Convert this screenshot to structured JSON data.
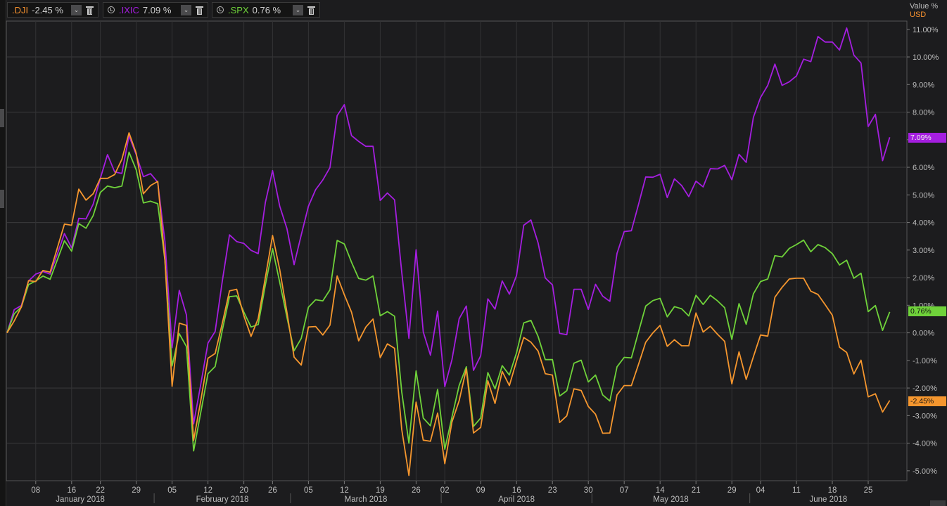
{
  "tabs": [
    {
      "symbol": ".DJI",
      "value": "-2.45 %",
      "color": "#f5902e",
      "has_clock": false
    },
    {
      "symbol": ".IXIC",
      "value": "7.09 %",
      "color": "#a51ee0",
      "has_clock": true
    },
    {
      "symbol": ".SPX",
      "value": "0.76 %",
      "color": "#6fd23a",
      "has_clock": true
    }
  ],
  "axis_header": {
    "title": "Value %",
    "currency": "USD"
  },
  "last_value_labels": [
    {
      "series": ".IXIC",
      "text": "7.09%",
      "bg": "#a51ee0",
      "fg": "#f0f0f0"
    },
    {
      "series": ".SPX",
      "text": "0.76%",
      "bg": "#6fd23a",
      "fg": "#111111"
    },
    {
      "series": ".DJI",
      "text": "-2.45%",
      "bg": "#f5962e",
      "fg": "#111111"
    }
  ],
  "chart_data": {
    "type": "line",
    "title": "",
    "ylabel": "Value %",
    "ylim": [
      -5.36,
      11.3
    ],
    "y_ticks": [
      "11.00%",
      "10.00%",
      "9.00%",
      "8.00%",
      "7.00%",
      "6.00%",
      "5.00%",
      "4.00%",
      "3.00%",
      "2.00%",
      "1.00%",
      "0.00%",
      "-1.00%",
      "-2.00%",
      "-3.00%",
      "-4.00%",
      "-5.00%"
    ],
    "y_tick_values": [
      11,
      10,
      9,
      8,
      7,
      6,
      5,
      4,
      3,
      2,
      1,
      0,
      -1,
      -2,
      -3,
      -4,
      -5
    ],
    "grid": true,
    "x_count": 124,
    "x_ticks": [
      {
        "label": "08",
        "i": 4
      },
      {
        "label": "16",
        "i": 9
      },
      {
        "label": "22",
        "i": 13
      },
      {
        "label": "29",
        "i": 18
      },
      {
        "label": "05",
        "i": 23
      },
      {
        "label": "12",
        "i": 28
      },
      {
        "label": "20",
        "i": 33
      },
      {
        "label": "26",
        "i": 37
      },
      {
        "label": "05",
        "i": 42
      },
      {
        "label": "12",
        "i": 47
      },
      {
        "label": "19",
        "i": 52
      },
      {
        "label": "26",
        "i": 57
      },
      {
        "label": "02",
        "i": 61
      },
      {
        "label": "09",
        "i": 66
      },
      {
        "label": "16",
        "i": 71
      },
      {
        "label": "23",
        "i": 76
      },
      {
        "label": "30",
        "i": 81
      },
      {
        "label": "07",
        "i": 86
      },
      {
        "label": "14",
        "i": 91
      },
      {
        "label": "21",
        "i": 96
      },
      {
        "label": "29",
        "i": 101
      },
      {
        "label": "04",
        "i": 105
      },
      {
        "label": "11",
        "i": 110
      },
      {
        "label": "18",
        "i": 115
      },
      {
        "label": "25",
        "i": 120
      }
    ],
    "months": [
      {
        "label": "January 2018",
        "start": 0
      },
      {
        "label": "February 2018",
        "start": 21
      },
      {
        "label": "March 2018",
        "start": 40
      },
      {
        "label": "April 2018",
        "start": 61
      },
      {
        "label": "May 2018",
        "start": 82
      },
      {
        "label": "June 2018",
        "start": 104
      }
    ],
    "series": [
      {
        "name": ".IXIC",
        "color": "#a51ee0",
        "values": [
          0,
          0.84,
          0.99,
          1.88,
          2.13,
          2.22,
          2.13,
          2.85,
          3.6,
          3.08,
          4.15,
          4.13,
          4.66,
          5.6,
          6.46,
          5.83,
          5.78,
          7.14,
          6.46,
          5.66,
          5.77,
          5.46,
          3.32,
          -0.54,
          1.54,
          0.65,
          -3.3,
          -1.86,
          -0.37,
          0.05,
          1.88,
          3.55,
          3.31,
          3.24,
          2.99,
          2.87,
          4.73,
          5.88,
          4.59,
          3.78,
          2.47,
          3.55,
          4.59,
          5.19,
          5.54,
          5.99,
          7.87,
          8.27,
          7.15,
          6.94,
          6.76,
          6.76,
          4.8,
          5.07,
          4.82,
          2.2,
          -0.2,
          3.01,
          0.03,
          -0.81,
          0.79,
          -1.95,
          -0.97,
          0.51,
          0.97,
          -1.36,
          -0.83,
          1.23,
          0.86,
          1.88,
          1.4,
          2.08,
          3.9,
          4.09,
          3.26,
          1.99,
          1.74,
          -0.02,
          -0.07,
          1.58,
          1.58,
          0.85,
          1.76,
          1.33,
          1.14,
          2.88,
          3.67,
          3.7,
          4.66,
          5.65,
          5.64,
          5.75,
          4.9,
          5.58,
          5.34,
          4.94,
          5.5,
          5.29,
          5.95,
          5.94,
          6.07,
          5.55,
          6.47,
          6.18,
          7.81,
          8.53,
          8.97,
          9.74,
          8.97,
          9.1,
          9.31,
          9.92,
          9.83,
          10.74,
          10.54,
          10.54,
          10.25,
          11.05,
          10.07,
          9.78,
          7.48,
          7.92,
          6.24,
          7.09
        ]
      },
      {
        "name": ".SPX",
        "color": "#6fd23a",
        "values": [
          0,
          0.69,
          0.94,
          1.75,
          1.88,
          2.06,
          1.94,
          2.64,
          3.34,
          2.96,
          3.96,
          3.79,
          4.25,
          5.09,
          5.32,
          5.26,
          5.32,
          6.55,
          5.91,
          4.71,
          4.77,
          4.68,
          2.64,
          -1.2,
          -0.03,
          -0.5,
          -4.28,
          -2.88,
          -1.48,
          -1.22,
          0.1,
          1.31,
          1.34,
          0.75,
          0.21,
          0.3,
          1.74,
          3.05,
          1.83,
          0.57,
          -0.65,
          -0.2,
          0.93,
          1.2,
          1.16,
          1.56,
          3.35,
          3.22,
          2.56,
          1.97,
          1.91,
          2.06,
          0.62,
          0.77,
          0.6,
          -2.14,
          -4.0,
          -1.38,
          -3.09,
          -3.37,
          -2.05,
          -4.22,
          -3.05,
          -1.91,
          -1.23,
          -3.39,
          -3.09,
          -1.44,
          -2.03,
          -1.19,
          -1.53,
          -0.72,
          0.36,
          0.45,
          -0.13,
          -0.97,
          -0.97,
          -2.29,
          -2.1,
          -1.1,
          -0.99,
          -1.78,
          -1.53,
          -2.25,
          -2.47,
          -1.23,
          -0.89,
          -0.91,
          0.04,
          0.97,
          1.17,
          1.25,
          0.58,
          0.95,
          0.87,
          0.61,
          1.36,
          1.03,
          1.36,
          1.16,
          0.91,
          -0.24,
          1.06,
          0.31,
          1.41,
          1.86,
          1.95,
          2.8,
          2.75,
          3.06,
          3.2,
          3.36,
          2.94,
          3.2,
          3.09,
          2.87,
          2.46,
          2.63,
          1.98,
          2.16,
          0.77,
          0.99,
          0.09,
          0.76
        ]
      },
      {
        "name": ".DJI",
        "color": "#f5962e",
        "values": [
          0,
          0.43,
          0.94,
          1.89,
          1.86,
          2.26,
          2.2,
          3.07,
          3.94,
          3.9,
          5.21,
          4.81,
          5.04,
          5.6,
          5.6,
          5.74,
          6.29,
          7.25,
          6.51,
          5.04,
          5.34,
          5.49,
          2.64,
          -1.94,
          0.35,
          0.27,
          -3.9,
          -2.45,
          -0.92,
          -0.75,
          0.35,
          1.52,
          1.58,
          0.62,
          -0.13,
          0.52,
          2.01,
          3.53,
          2.29,
          0.75,
          -0.88,
          -1.17,
          0.21,
          0.23,
          -0.08,
          0.28,
          2.06,
          1.38,
          0.75,
          -0.29,
          0.21,
          0.5,
          -0.9,
          -0.4,
          -0.56,
          -3.5,
          -5.17,
          -2.51,
          -3.89,
          -3.93,
          -2.91,
          -4.74,
          -3.23,
          -2.46,
          -1.31,
          -3.63,
          -3.43,
          -1.74,
          -2.56,
          -1.4,
          -1.91,
          -1.02,
          -0.17,
          -0.34,
          -0.66,
          -1.48,
          -1.53,
          -3.25,
          -3.01,
          -2.03,
          -2.09,
          -2.67,
          -2.95,
          -3.64,
          -3.63,
          -2.25,
          -1.91,
          -1.91,
          -1.14,
          -0.34,
          0.0,
          0.27,
          -0.49,
          -0.25,
          -0.47,
          -0.47,
          0.72,
          0.03,
          0.24,
          -0.05,
          -0.31,
          -1.85,
          -0.69,
          -1.69,
          -0.87,
          -0.08,
          -0.12,
          1.29,
          1.65,
          1.95,
          1.98,
          1.98,
          1.51,
          1.39,
          1.02,
          0.64,
          -0.52,
          -0.71,
          -1.49,
          -0.99,
          -2.32,
          -2.21,
          -2.87,
          -2.45
        ]
      }
    ]
  }
}
